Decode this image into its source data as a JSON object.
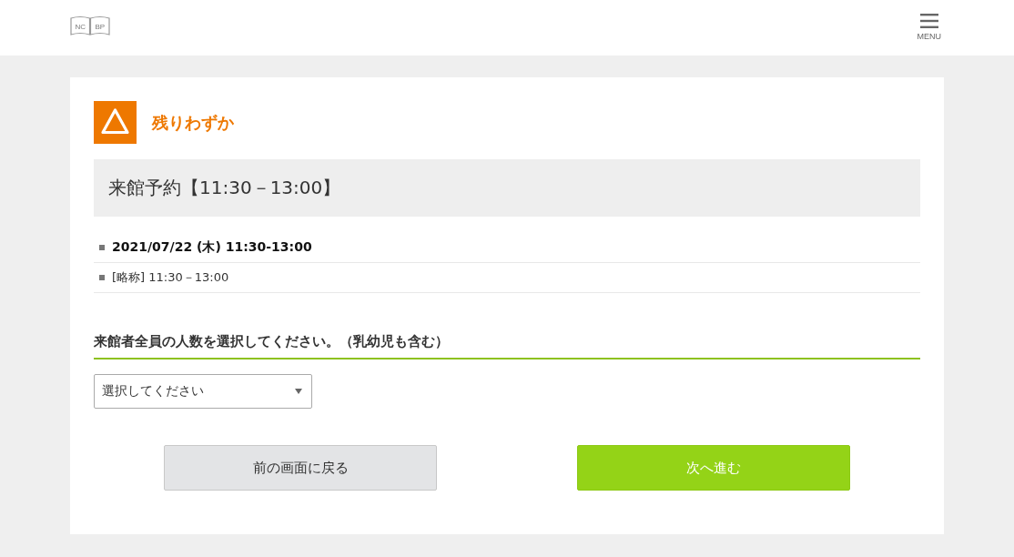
{
  "header": {
    "logo": {
      "left": "NC",
      "right": "BP"
    },
    "menu": {
      "label": "MENU"
    }
  },
  "status": {
    "kind": "few",
    "label": "残りわずか"
  },
  "event": {
    "title": "来館予約【11:30－13:00】",
    "details": [
      {
        "text": "2021/07/22 (木) 11:30-13:00",
        "emphasis": true
      },
      {
        "text": "[略称] 11:30－13:00",
        "emphasis": false
      }
    ]
  },
  "question": {
    "label": "来館者全員の人数を選択してください。（乳幼児も含む）",
    "select": {
      "placeholder": "選択してください"
    }
  },
  "buttons": [
    {
      "label": "前の画面に戻る",
      "kind": "secondary"
    },
    {
      "label": "次へ進む",
      "kind": "primary"
    }
  ]
}
